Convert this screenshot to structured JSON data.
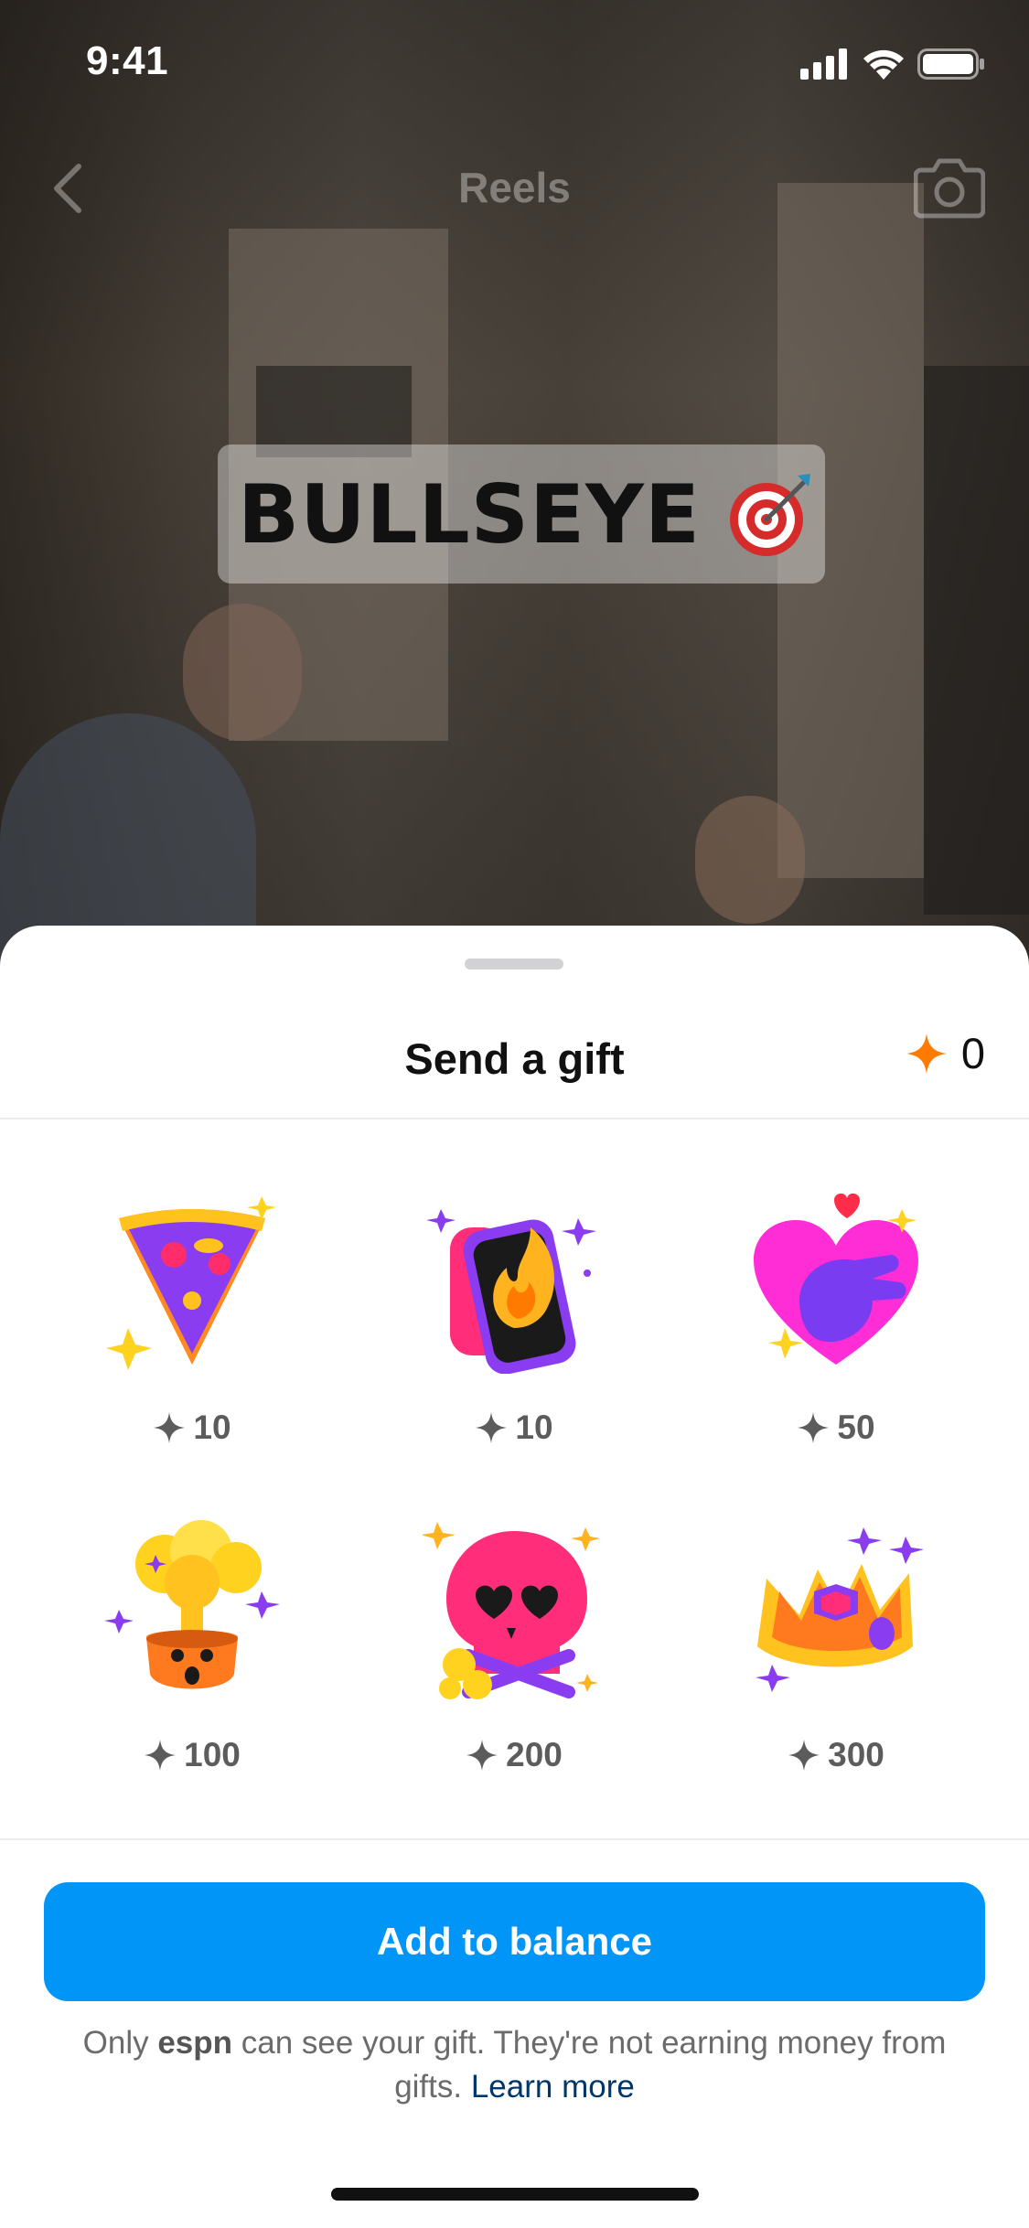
{
  "status_bar": {
    "time": "9:41"
  },
  "nav": {
    "title": "Reels"
  },
  "sticker": {
    "text": "BULLSEYE"
  },
  "sheet": {
    "title": "Send a gift",
    "balance": "0",
    "gifts": [
      {
        "name": "Pizza",
        "price": "10"
      },
      {
        "name": "Phone on fire",
        "price": "10"
      },
      {
        "name": "Finger heart",
        "price": "50"
      },
      {
        "name": "Mind blown",
        "price": "100"
      },
      {
        "name": "Heart-eyes skull",
        "price": "200"
      },
      {
        "name": "Crown",
        "price": "300"
      }
    ],
    "cta_label": "Add to balance",
    "footnote": {
      "prefix": "Only ",
      "account": "espn",
      "middle": " can see your gift. They're not earning money from gifts. ",
      "link": "Learn more"
    }
  },
  "colors": {
    "accent_blue": "#0095f6",
    "star_orange": "#ff7a00",
    "link_navy": "#00376b"
  }
}
